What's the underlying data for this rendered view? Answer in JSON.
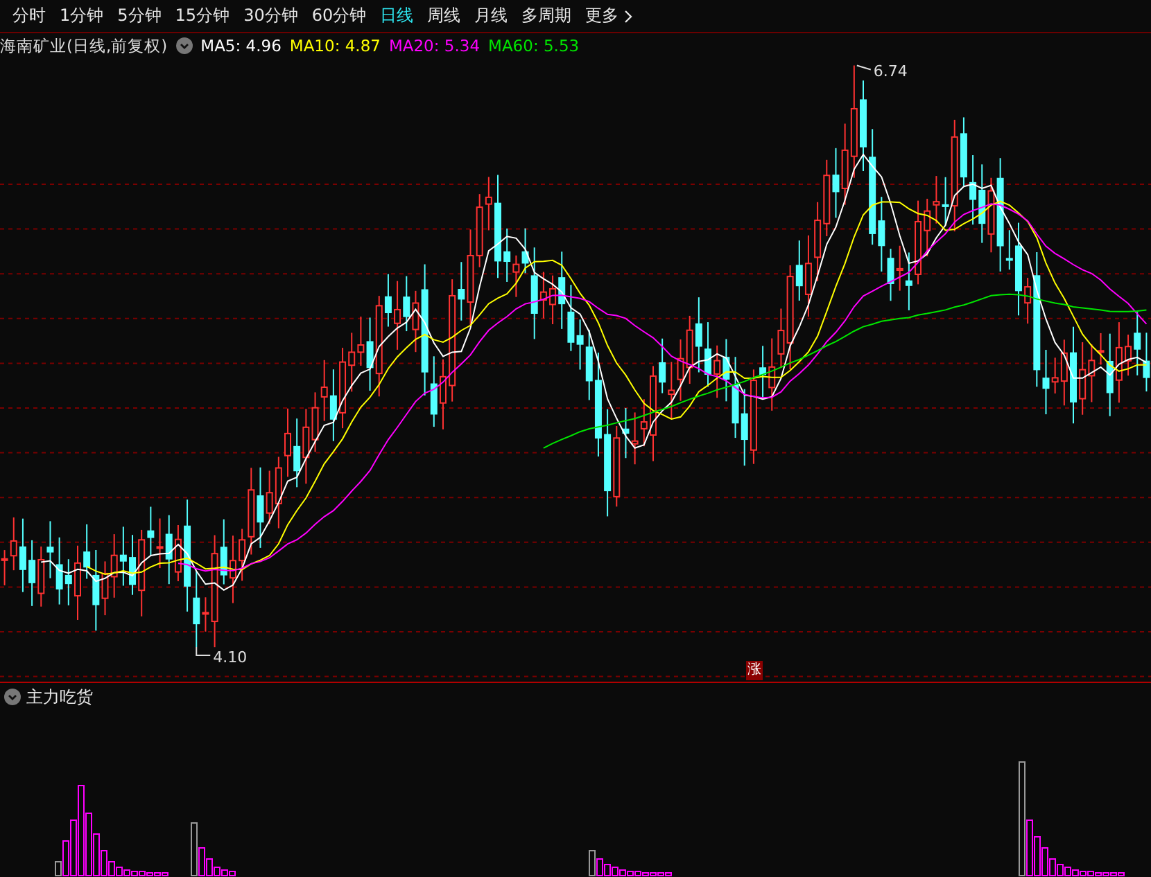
{
  "tabs": [
    {
      "label": "分时",
      "kind": "period",
      "selected": false
    },
    {
      "label": "1分钟",
      "kind": "period",
      "selected": false
    },
    {
      "label": "5分钟",
      "kind": "period",
      "selected": false
    },
    {
      "label": "15分钟",
      "kind": "period",
      "selected": false
    },
    {
      "label": "30分钟",
      "kind": "period",
      "selected": false
    },
    {
      "label": "60分钟",
      "kind": "period",
      "selected": false
    },
    {
      "label": "日线",
      "kind": "period",
      "selected": true
    },
    {
      "label": "周线",
      "kind": "period",
      "selected": false
    },
    {
      "label": "月线",
      "kind": "period",
      "selected": false
    },
    {
      "label": "多周期",
      "kind": "period",
      "selected": false
    },
    {
      "label": "更多",
      "kind": "more",
      "selected": false
    }
  ],
  "legend": {
    "title": "海南矿业(日线,前复权)",
    "averages": [
      {
        "label": "MA5: 4.96",
        "color": "#ffffff"
      },
      {
        "label": "MA10: 4.87",
        "color": "#ffff00"
      },
      {
        "label": "MA20: 5.34",
        "color": "#ff00ff"
      },
      {
        "label": "MA60: 5.53",
        "color": "#00e600"
      }
    ]
  },
  "main_chart": {
    "high_label": "6.74",
    "low_label": "4.10",
    "badge": "涨"
  },
  "indicator_panel": {
    "title": "主力吃货"
  }
}
